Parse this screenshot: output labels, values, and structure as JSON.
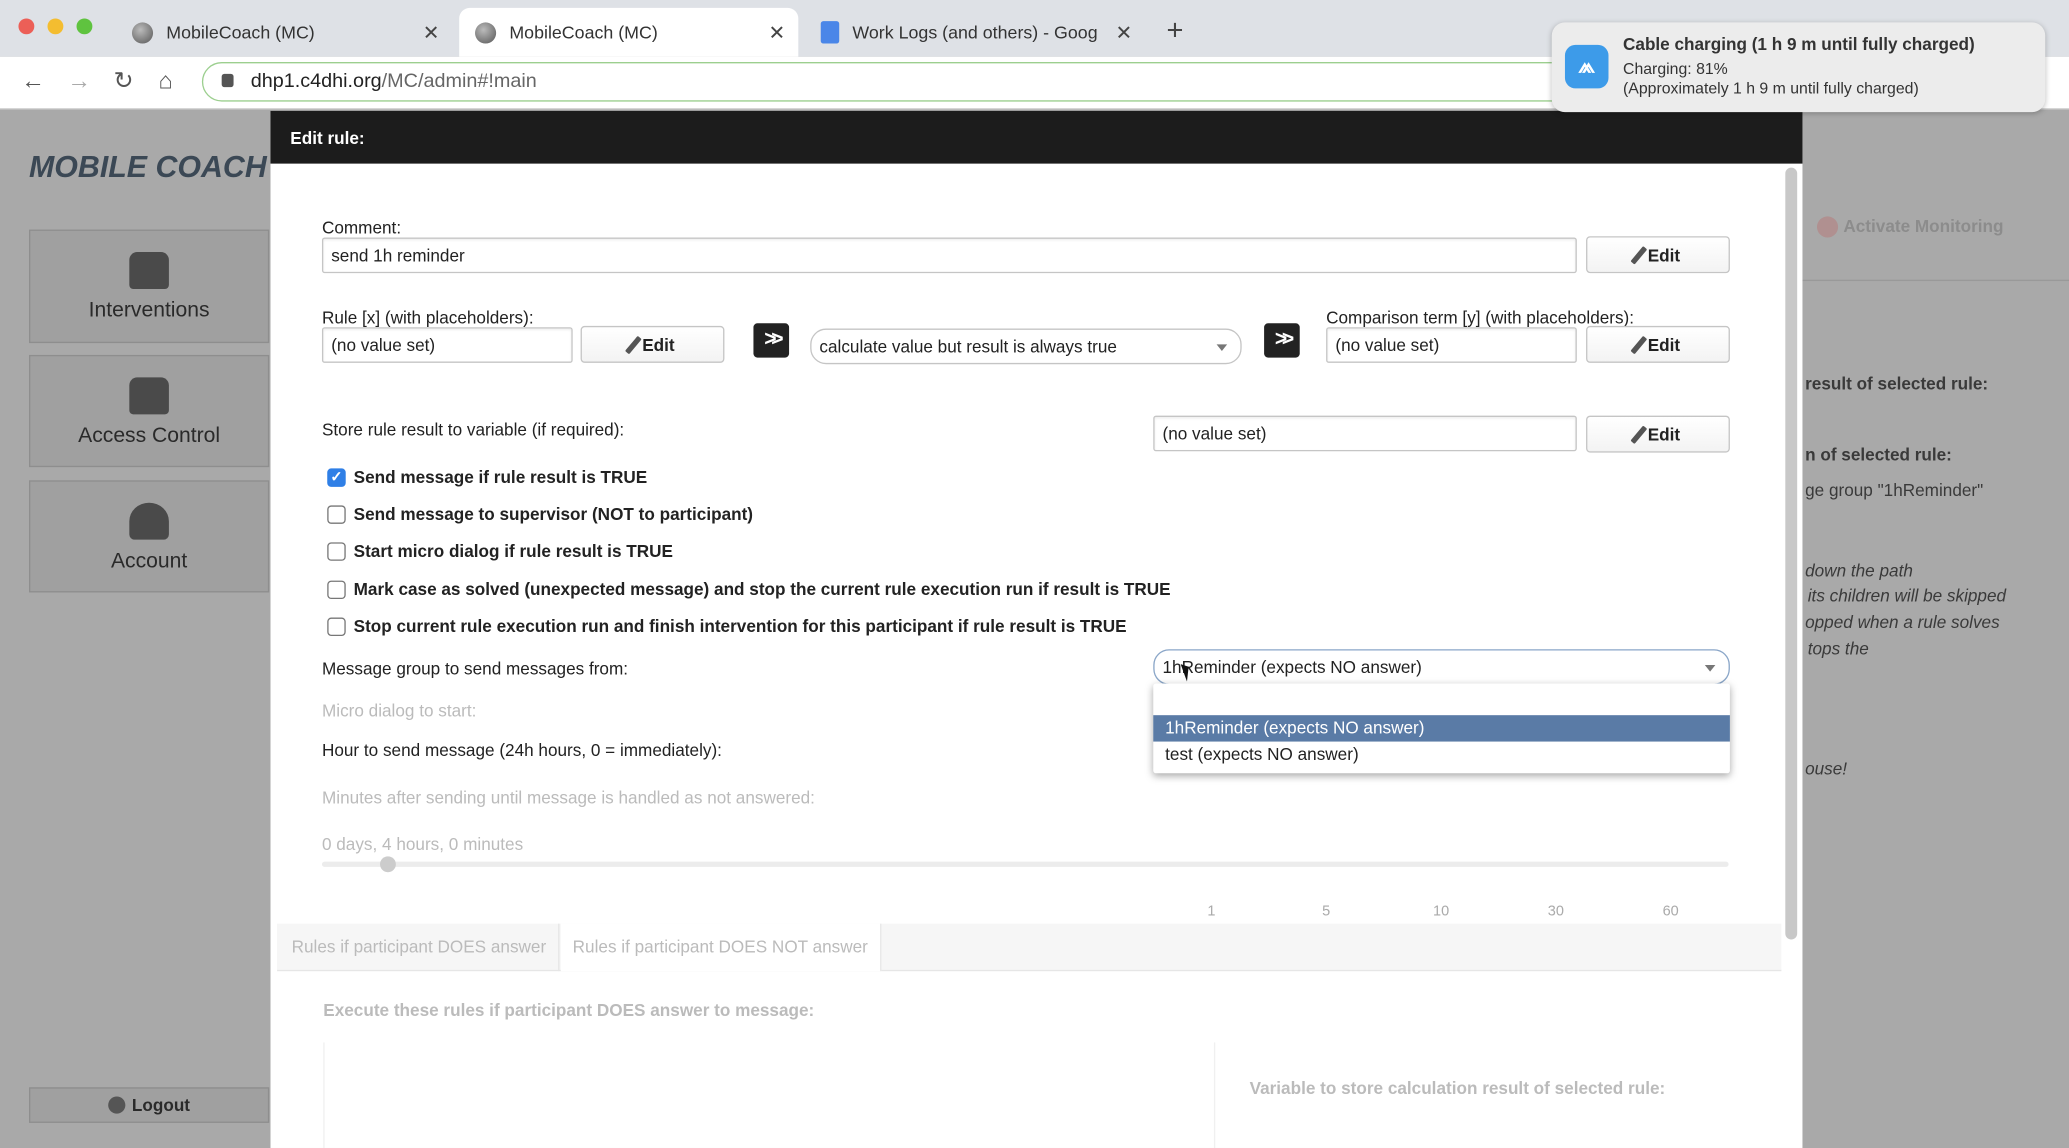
{
  "browser": {
    "tabs": [
      {
        "title": "MobileCoach (MC)",
        "active": false
      },
      {
        "title": "MobileCoach (MC)",
        "active": true
      },
      {
        "title": "Work Logs (and others) - Goog",
        "active": false
      }
    ],
    "url_host": "dhp1.c4dhi.org",
    "url_path": "/MC/admin#!main"
  },
  "notification": {
    "title": "Cable charging (1 h 9 m until fully charged)",
    "line1": "Charging: 81%",
    "line2": "(Approximately 1 h 9 m until fully charged)",
    "accent": "#3d9be9"
  },
  "app": {
    "logo": "MOBILE COACH",
    "sidebar": [
      {
        "label": "Interventions",
        "icon": "interventions-icon"
      },
      {
        "label": "Access Control",
        "icon": "lock-icon"
      },
      {
        "label": "Account",
        "icon": "user-icon"
      }
    ],
    "logout": "Logout",
    "monitoring": "Activate Monitoring",
    "background_text": [
      "result of selected rule:",
      "n of selected rule:",
      "ge group \"1hReminder\"",
      "down the path",
      "its children will be skipped",
      "opped when a rule solves",
      "tops the",
      "ouse!"
    ]
  },
  "modal": {
    "title": "Edit rule:",
    "comment_label": "Comment:",
    "comment_value": "send 1h reminder",
    "edit": "Edit",
    "rule_label": "Rule [x] (with placeholders):",
    "rule_value": "(no value set)",
    "operator_value": "calculate value but result is always true",
    "comparison_label": "Comparison term [y] (with placeholders):",
    "comparison_value": "(no value set)",
    "store_label": "Store rule result to variable (if required):",
    "store_value": "(no value set)",
    "checkboxes": [
      {
        "label": "Send message if rule result is TRUE",
        "checked": true
      },
      {
        "label": "Send message to supervisor (NOT to participant)",
        "checked": false
      },
      {
        "label": "Start micro dialog if rule result is TRUE",
        "checked": false
      },
      {
        "label": "Mark case as solved (unexpected message) and stop the current rule execution run if result is TRUE",
        "checked": false
      },
      {
        "label": "Stop current rule execution run and finish intervention for this participant if rule result is TRUE",
        "checked": false
      }
    ],
    "msg_group_label": "Message group to send messages from:",
    "msg_group_value": "1hReminder (expects NO answer)",
    "msg_group_options": [
      "",
      "1hReminder (expects NO answer)",
      "test (expects NO answer)"
    ],
    "micro_label": "Micro dialog to start:",
    "hour_label": "Hour to send message (24h hours, 0 = immediately):",
    "minutes_label": "Minutes after sending until message is handled as not answered:",
    "minutes_ticks": [
      "1",
      "5",
      "10",
      "30",
      "60"
    ],
    "duration_value": "0 days, 4 hours, 0 minutes",
    "tabs": [
      "Rules if participant DOES answer",
      "Rules if participant DOES NOT answer"
    ],
    "execute_label": "Execute these rules if participant DOES answer to message:",
    "variable_label": "Variable to store calculation result of selected rule:"
  }
}
